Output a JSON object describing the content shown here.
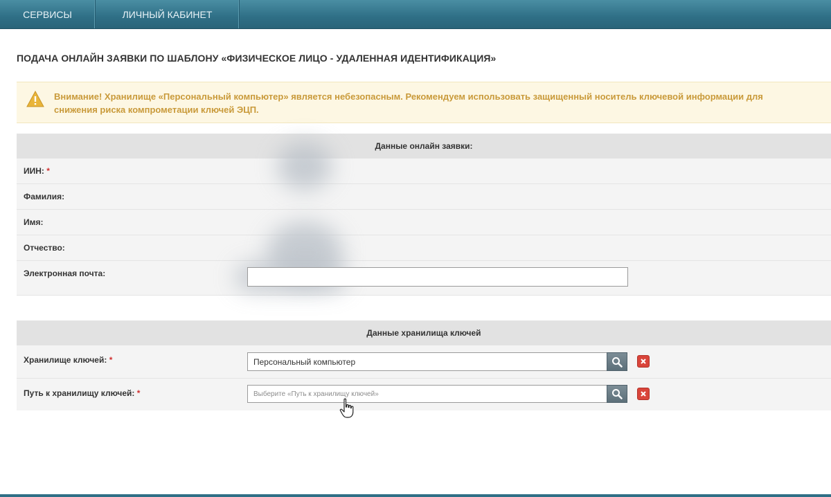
{
  "nav": {
    "services": "СЕРВИСЫ",
    "cabinet": "ЛИЧНЫЙ КАБИНЕТ"
  },
  "page": {
    "title": "ПОДАЧА ОНЛАЙН ЗАЯВКИ ПО ШАБЛОНУ «ФИЗИЧЕСКОЕ ЛИЦО - УДАЛЕННАЯ ИДЕНТИФИКАЦИЯ»"
  },
  "warning": {
    "icon": "warning-triangle-icon",
    "text": "Внимание! Хранилище «Персональный компьютер» является небезопасным. Рекомендуем использовать защищенный носитель ключевой информации для снижения риска компрометации ключей ЭЦП."
  },
  "application": {
    "header": "Данные онлайн заявки:",
    "fields": {
      "iin": "ИИН:",
      "surname": "Фамилия:",
      "name": "Имя:",
      "patronymic": "Отчество:",
      "email": "Электронная почта:"
    },
    "required_mark": "*"
  },
  "keystore": {
    "header": "Данные хранилища ключей",
    "storage_label": "Хранилище ключей:",
    "storage_value": "Персональный компьютер",
    "path_label": "Путь к хранилищу ключей:",
    "path_placeholder": "Выберите «Путь к хранилищу ключей»",
    "required_mark": "*"
  },
  "colors": {
    "nav": "#2f6f86",
    "warning_text": "#c99a3a",
    "warning_bg": "#fdf7e3",
    "required": "#d03030",
    "clear_button": "#d9453b"
  }
}
